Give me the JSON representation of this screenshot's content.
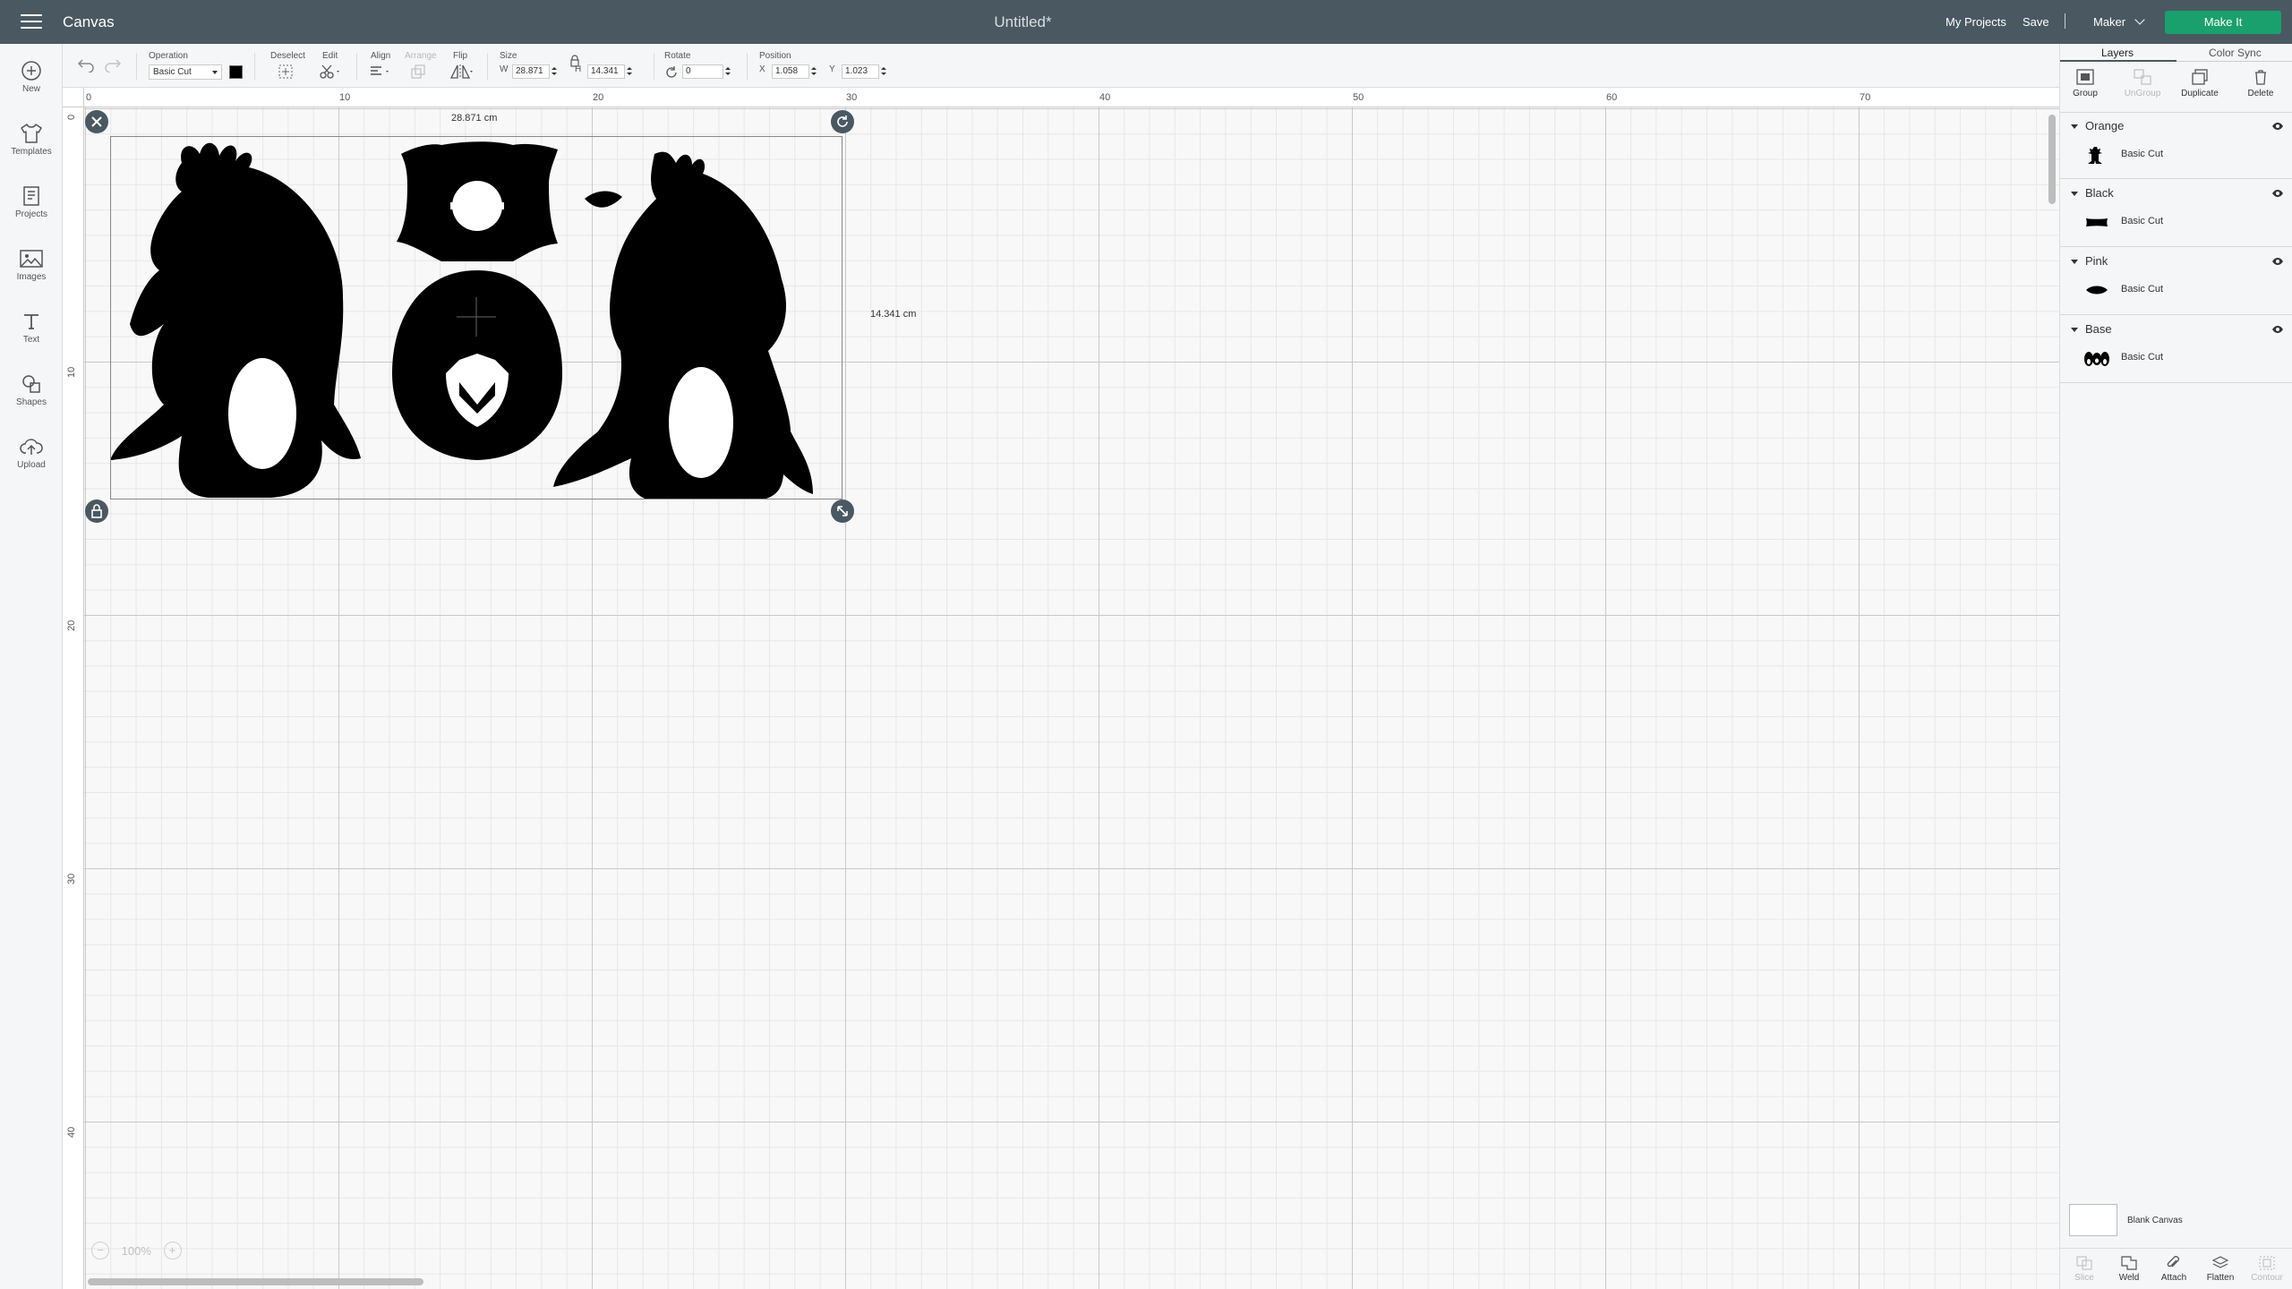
{
  "header": {
    "app_title": "Canvas",
    "doc_title": "Untitled*",
    "my_projects": "My Projects",
    "save": "Save",
    "separator": "|",
    "machine": "Maker",
    "make_it": "Make It"
  },
  "left_tools": [
    {
      "label": "New",
      "icon": "plus-circle-icon"
    },
    {
      "label": "Templates",
      "icon": "tshirt-icon"
    },
    {
      "label": "Projects",
      "icon": "projects-icon"
    },
    {
      "label": "Images",
      "icon": "image-icon"
    },
    {
      "label": "Text",
      "icon": "text-icon"
    },
    {
      "label": "Shapes",
      "icon": "shapes-icon"
    },
    {
      "label": "Upload",
      "icon": "upload-cloud-icon"
    }
  ],
  "edit_bar": {
    "operation_label": "Operation",
    "operation_value": "Basic Cut",
    "operation_color": "#000000",
    "deselect_label": "Deselect",
    "edit_label": "Edit",
    "align_label": "Align",
    "arrange_label": "Arrange",
    "flip_label": "Flip",
    "size_label": "Size",
    "w_prefix": "W",
    "w_value": "28.871",
    "h_prefix": "H",
    "h_value": "14.341",
    "rotate_label": "Rotate",
    "rotate_value": "0",
    "position_label": "Position",
    "x_prefix": "X",
    "x_value": "1.058",
    "y_prefix": "Y",
    "y_value": "1.023"
  },
  "canvas": {
    "ruler_top": [
      "0",
      "10",
      "20",
      "30",
      "40",
      "50",
      "60",
      "70"
    ],
    "ruler_left": [
      "0",
      "10",
      "20",
      "30",
      "40"
    ],
    "width_label": "28.871 cm",
    "height_label": "14.341 cm",
    "zoom": "100%",
    "zoom_out": "−",
    "zoom_in": "+"
  },
  "right_panel": {
    "tabs": [
      "Layers",
      "Color Sync"
    ],
    "tools": [
      {
        "label": "Group",
        "enabled": true
      },
      {
        "label": "UnGroup",
        "enabled": false
      },
      {
        "label": "Duplicate",
        "enabled": true
      },
      {
        "label": "Delete",
        "enabled": true
      }
    ],
    "layers": [
      {
        "name": "Orange",
        "item": "Basic Cut",
        "icon": "orange-layer-thumb-icon"
      },
      {
        "name": "Black",
        "item": "Basic Cut",
        "icon": "black-layer-thumb-icon"
      },
      {
        "name": "Pink",
        "item": "Basic Cut",
        "icon": "pink-layer-thumb-icon"
      },
      {
        "name": "Base",
        "item": "Basic Cut",
        "icon": "base-layer-thumb-icon"
      }
    ],
    "blank_canvas": "Blank Canvas",
    "bottom_tools": [
      {
        "label": "Slice",
        "enabled": false
      },
      {
        "label": "Weld",
        "enabled": true
      },
      {
        "label": "Attach",
        "enabled": true
      },
      {
        "label": "Flatten",
        "enabled": true
      },
      {
        "label": "Contour",
        "enabled": false
      }
    ]
  },
  "colors": {
    "header_bg": "#4a5862",
    "accent_green": "#1aa06d",
    "artwork": "#000000"
  }
}
